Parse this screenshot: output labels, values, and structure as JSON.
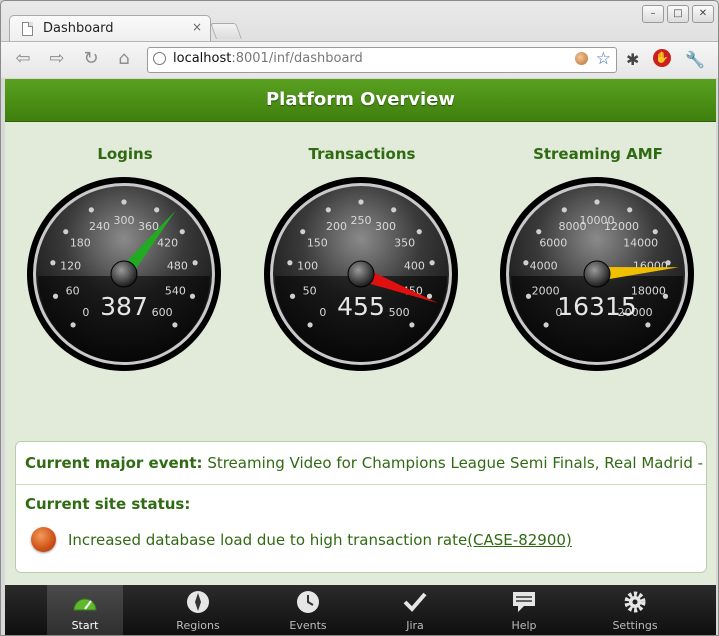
{
  "browser": {
    "tab_title": "Dashboard",
    "tab_close": "×",
    "url_host": "localhost",
    "url_rest": ":8001/inf/dashboard",
    "window_controls": [
      "–",
      "□",
      "✕"
    ]
  },
  "header": {
    "title": "Platform Overview"
  },
  "gauges": [
    {
      "title": "Logins",
      "value": "387",
      "numeric": 387,
      "ticks": [
        "0",
        "60",
        "120",
        "180",
        "240",
        "300",
        "360",
        "420",
        "480",
        "540",
        "600"
      ],
      "max": 600,
      "needle_color": "#22aa22"
    },
    {
      "title": "Transactions",
      "value": "455",
      "numeric": 455,
      "ticks": [
        "0",
        "50",
        "100",
        "150",
        "200",
        "250",
        "300",
        "350",
        "400",
        "450",
        "500"
      ],
      "max": 500,
      "needle_color": "#e01010"
    },
    {
      "title": "Streaming AMF",
      "value": "16315",
      "numeric": 16315,
      "ticks": [
        "0",
        "2000",
        "4000",
        "6000",
        "8000",
        "10000",
        "12000",
        "14000",
        "16000",
        "18000",
        "20000"
      ],
      "max": 20000,
      "needle_color": "#f0c000"
    }
  ],
  "panel": {
    "major_event_label": "Current major event:",
    "major_event_text": "Streaming Video for Champions League Semi Finals, Real Madrid - Ba...",
    "site_status_label": "Current site status:",
    "status_text": "Increased database load due to high transaction rate",
    "status_link": "(CASE-82900)",
    "status_color": "#d2561b"
  },
  "nav": [
    {
      "label": "Start",
      "icon": "gauge-icon",
      "active": true
    },
    {
      "label": "Regions",
      "icon": "compass-icon",
      "active": false
    },
    {
      "label": "Events",
      "icon": "clock-icon",
      "active": false
    },
    {
      "label": "Jira",
      "icon": "checkmark-icon",
      "active": false
    },
    {
      "label": "Help",
      "icon": "speech-bubble-icon",
      "active": false
    },
    {
      "label": "Settings",
      "icon": "gear-icon",
      "active": false
    }
  ]
}
